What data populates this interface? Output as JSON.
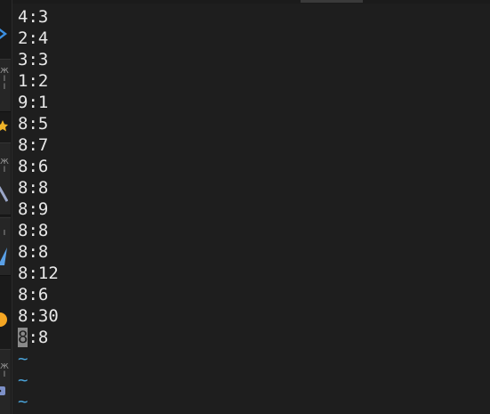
{
  "editor": {
    "lines": [
      "4:3",
      "2:4",
      "3:3",
      "1:2",
      "9:1",
      "8:5",
      "8:7",
      "8:6",
      "8:8",
      "8:9",
      "8:8",
      "8:8",
      "8:12",
      "8:6",
      "8:30"
    ],
    "last_line": {
      "cursor_char": "8",
      "rest": ":8"
    },
    "empty_line_marker": "~"
  },
  "colors": {
    "background": "#1e1e1e",
    "text": "#e8e8e8",
    "tilde": "#4aa3d9",
    "cursor": "#8a8a8a",
    "dock_arrow": "#3b8fe0",
    "dock_star": "#f0b429",
    "dock_circle": "#f5a623"
  },
  "dock": {
    "icons": [
      "chevron-right-icon",
      "star-icon",
      "tool-icon",
      "paper-plane-icon",
      "circle-icon",
      "robot-icon"
    ]
  }
}
